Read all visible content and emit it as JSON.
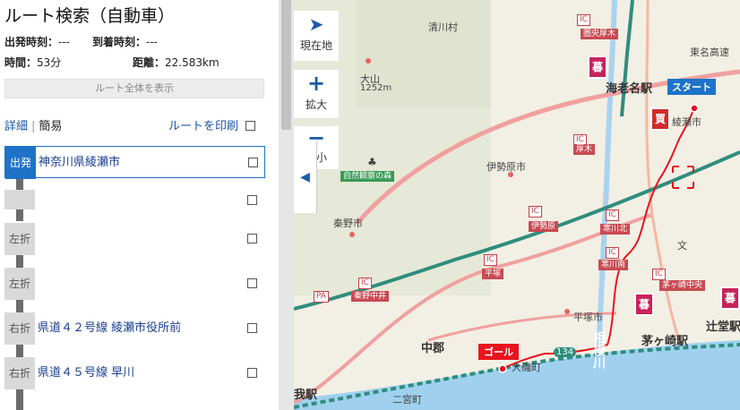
{
  "title": "ルート検索（自動車）",
  "meta": {
    "depart_label": "出発時刻：",
    "depart_value": "---",
    "arrive_label": "到着時刻：",
    "arrive_value": "---",
    "time_label": "時間：",
    "time_value": "53分",
    "distance_label": "距離：",
    "distance_value": "22.583km"
  },
  "show_all_label": "ルート全体を表示",
  "tabs": {
    "detail": "詳細",
    "simple": "簡易"
  },
  "print_label": "ルートを印刷",
  "steps": [
    {
      "badge": "出発",
      "label": "神奈川県綾瀬市"
    },
    {
      "badge": "",
      "label": ""
    },
    {
      "badge": "左折",
      "label": ""
    },
    {
      "badge": "左折",
      "label": ""
    },
    {
      "badge": "右折",
      "label": "県道４２号線 綾瀬市役所前"
    },
    {
      "badge": "右折",
      "label": "県道４５号線 早川"
    }
  ],
  "map_controls": {
    "current": "現在地",
    "zoom_in": "拡大",
    "zoom_out": "縮小"
  },
  "map_labels": {
    "kiyokawa": "清川村",
    "oyama": "大山",
    "oyama_height": "1252m",
    "shizen": "自然観察の森",
    "isehara": "伊勢原市",
    "hadano": "秦野市",
    "ebina": "海老名駅",
    "ayase": "綾瀬市",
    "higashi_meisho": "東名高速",
    "chuo": "中郡",
    "hiratsuka": "平塚市",
    "chigasaki": "茅ヶ崎駅",
    "tsujido": "辻堂駅",
    "oiso": "大磯町",
    "ninomiya": "二宮町",
    "sagamigawa": "相模川",
    "route134": "134",
    "ga_eki": "我駅",
    "pa": "PA",
    "start": "スタート",
    "goal": "ゴール",
    "ic": "IC",
    "ic_ken_atsugi": "圏央厚木",
    "ic_atsugi": "厚木",
    "ic_isehara": "伊勢原",
    "ic_samukawakita": "寒川北",
    "ic_samukawaminami": "寒川南",
    "ic_hiratsuka": "平塚",
    "ic_hadano_nakai": "秦野中井",
    "ic_chigasaki_chuo": "茅ヶ崎中央",
    "pin_kure": "暮",
    "pin_kai": "買",
    "bun": "文"
  },
  "colors": {
    "accent_blue": "#1e73c8",
    "route_red": "#e8141e",
    "sea": "#9fd1ef",
    "expressway": "#2f8d7d",
    "major_road": "#f0a0a0"
  }
}
